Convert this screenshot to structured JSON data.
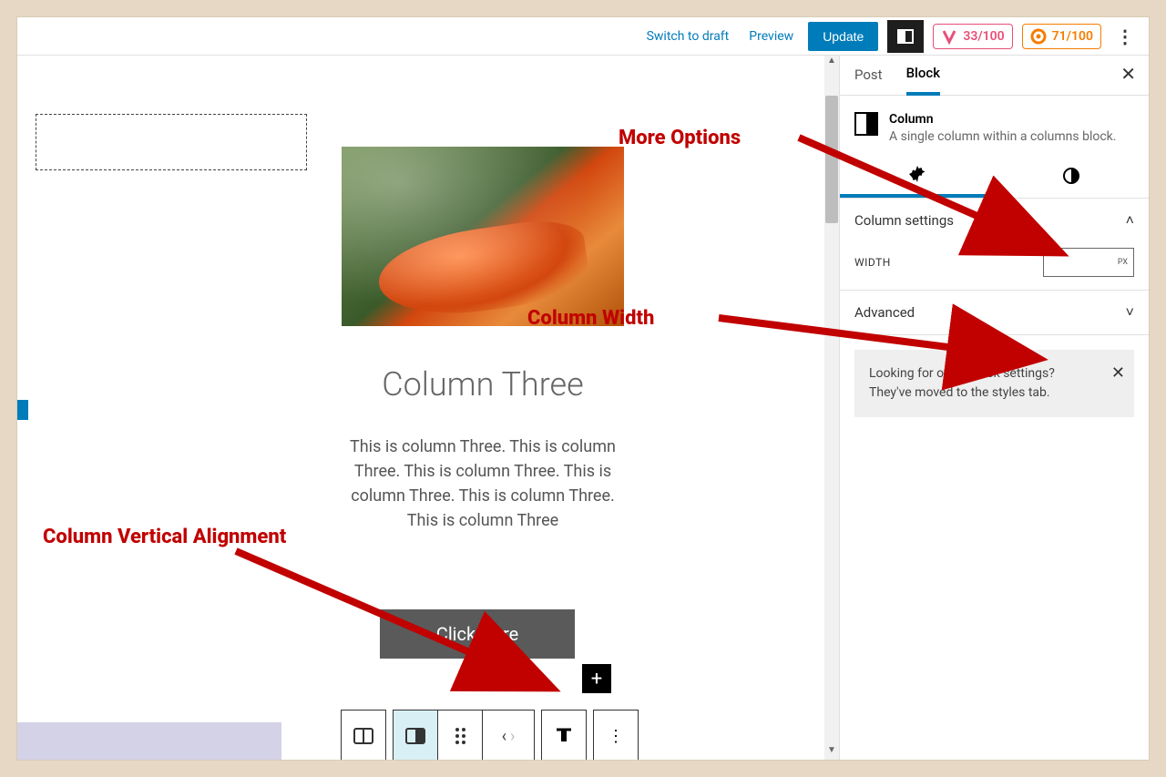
{
  "header": {
    "switch_draft": "Switch to draft",
    "preview": "Preview",
    "update": "Update",
    "score1": "33/100",
    "score2": "71/100"
  },
  "canvas": {
    "title": "Column Three",
    "body": "This is column Three. This is column Three. This is column Three. This is column Three. This is column Three. This is column Three",
    "button": "Click Here"
  },
  "sidebar": {
    "tab_post": "Post",
    "tab_block": "Block",
    "block_name": "Column",
    "block_desc": "A single column within a columns block.",
    "panel_settings": "Column settings",
    "width_label": "WIDTH",
    "width_unit": "PX",
    "panel_advanced": "Advanced",
    "info": "Looking for other block settings? They've moved to the styles tab."
  },
  "annotations": {
    "more": "More Options",
    "width": "Column Width",
    "valign": "Column Vertical Alignment"
  }
}
